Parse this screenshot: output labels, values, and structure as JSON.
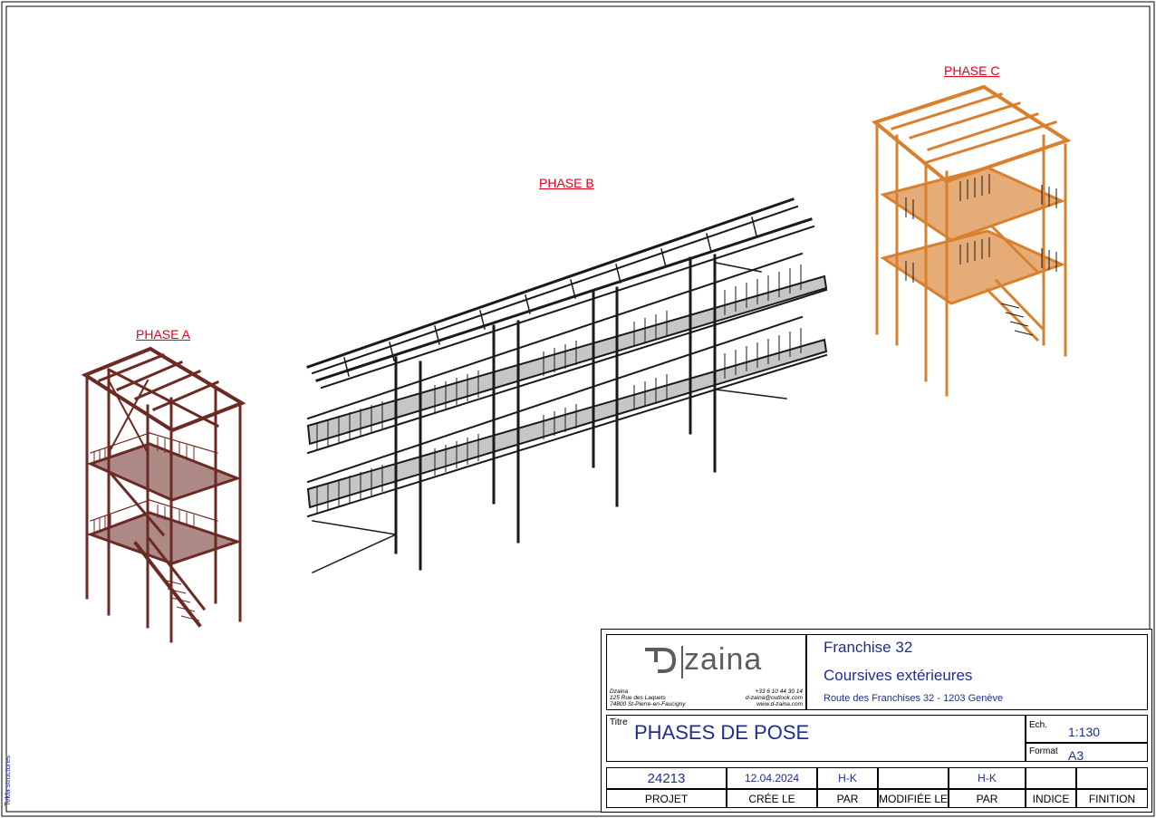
{
  "phases": {
    "a": "PHASE A",
    "b": "PHASE B",
    "c": "PHASE C"
  },
  "side_note": "Tekla structures",
  "company": {
    "logo_text": "zaina",
    "name": "Dzaina",
    "street": "125 Rue des Laquets",
    "city": "74800 St-Pierre-en-Faucigny",
    "phone": "+33 6 10 44 30 14",
    "email": "d-zaina@outlook.com",
    "web": "www.d-zaina.com"
  },
  "project": {
    "name": "Franchise 32",
    "subject": "Coursives extérieures",
    "address": "Route des Franchises 32 - 1203 Genève"
  },
  "title_block": {
    "title_label": "Titre",
    "title": "PHASES DE POSE",
    "scale_label": "Ech.",
    "scale": "1:130",
    "format_label": "Format",
    "format": "A3"
  },
  "info_values": {
    "projet": "24213",
    "cree_le": "12.04.2024",
    "par": "H-K",
    "modifiee_le": "",
    "par2": "H-K",
    "indice": "",
    "finition": ""
  },
  "info_labels": {
    "projet": "PROJET",
    "cree_le": "CRÉE LE",
    "par": "PAR",
    "modifiee_le": "MODIFIÉE LE",
    "par2": "PAR",
    "indice": "INDICE",
    "finition": "FINITION"
  },
  "colors": {
    "phase_label": "#e0001b",
    "phase_a_structure": "#6b2a24",
    "phase_b_structure": "#1a1a1a",
    "phase_c_structure": "#d9802e",
    "title_text": "#1f2e8c"
  }
}
